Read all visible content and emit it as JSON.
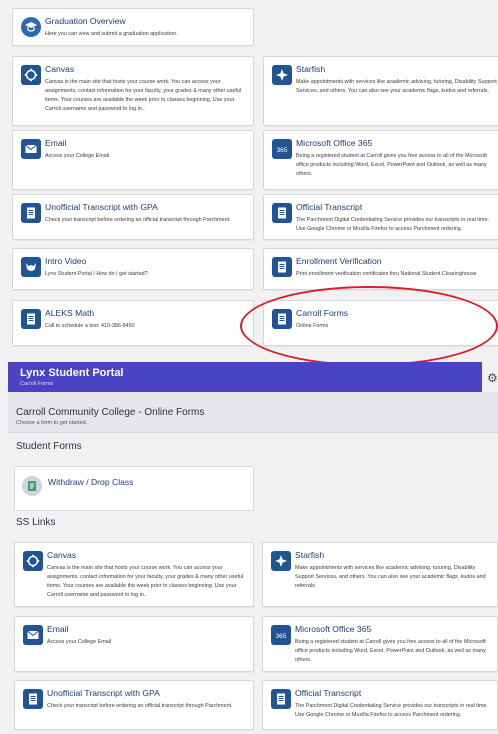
{
  "top_cards": [
    {
      "title": "Graduation Overview",
      "desc": "Here you can view and submit a graduation application.",
      "icon": "graduation-icon"
    },
    {
      "title": "Canvas",
      "desc": "Canvas is the main site that hosts your course work. You can access your assignments, contact information for your faculty, your grades & many other useful items. Your courses are available the week prior to classes beginning. Use your Carroll username and password to log in..",
      "icon": "canvas-icon"
    },
    {
      "title": "Starfish",
      "desc": "Make appointments with services like academic advising, tutoring, Disability Support Services, and others. You can also see your academic flags, kudos and referrals.",
      "icon": "starfish-icon"
    },
    {
      "title": "Email",
      "desc": "Access your College Email",
      "icon": "email-icon"
    },
    {
      "title": "Microsoft Office 365",
      "desc": "Being a registered student at Carroll gives you free access to all of the Microsoft office products including Word, Excel, PowerPoint and Outlook, as well as many others.",
      "icon": "office365-icon"
    },
    {
      "title": "Unofficial Transcript with GPA",
      "desc": "Check your transcript before ordering an official transcript through Parchment.",
      "icon": "transcript-icon"
    },
    {
      "title": "Official Transcript",
      "desc": "The Parchment Digital Credentialing Service provides our transcripts in real time. Use Google Chrome or Mozilla Firefox to access Parchment ordering.",
      "icon": "transcript-icon"
    },
    {
      "title": "Intro Video",
      "desc": "Lynx Student Portal / How do I get started?",
      "icon": "lynx-icon"
    },
    {
      "title": "Enrollment Verification",
      "desc": "Print enrollment verification certificates thru National Student Clearinghouse",
      "icon": "document-icon"
    },
    {
      "title": "ALEKS Math",
      "desc": "Call to schedule a test: 410-386-8450",
      "icon": "document-icon"
    },
    {
      "title": "Carroll Forms",
      "desc": "Online Forms",
      "icon": "document-icon"
    }
  ],
  "header": {
    "title": "Lynx Student Portal",
    "subtitle": "Carroll Forms"
  },
  "page": {
    "title": "Carroll Community College - Online Forms",
    "subtitle": "Choose a form to get started."
  },
  "sections": {
    "student_forms": "Student Forms",
    "ss_links": "SS Links"
  },
  "form_card": {
    "title": "Withdraw / Drop Class",
    "icon": "form-icon"
  },
  "bottom_cards": [
    {
      "title": "Canvas",
      "desc": "Canvas is the main site that hosts your course work. You can access your assignments, contact information for your faculty, your grades & many other useful items. Your courses are available the week prior to classes beginning. Use your Carroll username and password to log in..",
      "icon": "canvas-icon"
    },
    {
      "title": "Starfish",
      "desc": "Make appointments with services like academic advising, tutoring, Disability Support Services, and others. You can also see your academic flags, kudos and referrals.",
      "icon": "starfish-icon"
    },
    {
      "title": "Email",
      "desc": "Access your College Email",
      "icon": "email-icon"
    },
    {
      "title": "Microsoft Office 365",
      "desc": "Being a registered student at Carroll gives you free access to all of the Microsoft office products including Word, Excel, PowerPoint and Outlook, as well as many others.",
      "icon": "office365-icon"
    },
    {
      "title": "Unofficial Transcript with GPA",
      "desc": "Check your transcript before ordering an official transcript through Parchment.",
      "icon": "transcript-icon"
    },
    {
      "title": "Official Transcript",
      "desc": "The Parchment Digital Credentialing Service provides our transcripts in real time. Use Google Chrome or Mozilla Firefox to access Parchment ordering.",
      "icon": "transcript-icon"
    }
  ],
  "colors": {
    "header_bg": "#4a44c4",
    "icon_bg": "#205493",
    "title_text": "#1d3d7a",
    "highlight_ring": "#d91f26"
  }
}
